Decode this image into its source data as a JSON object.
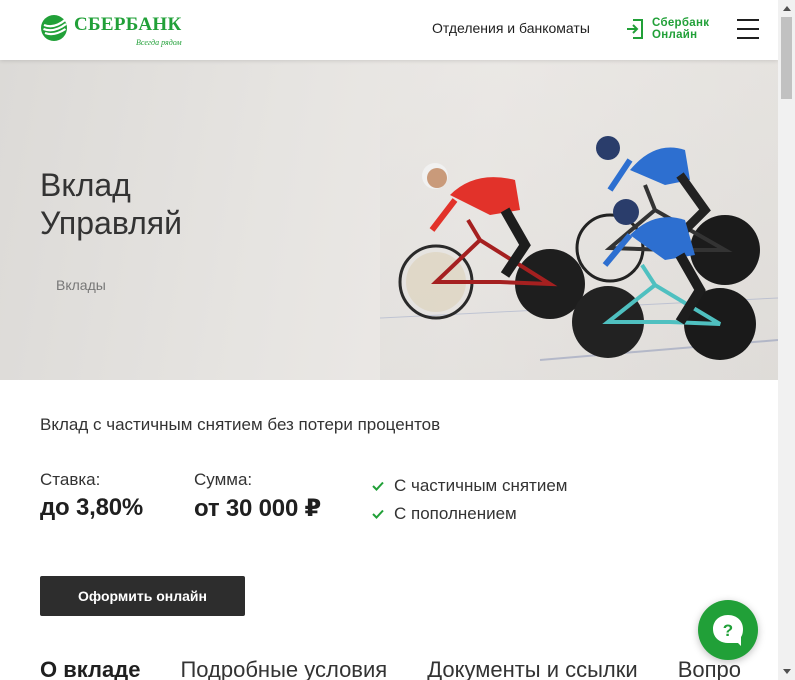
{
  "colors": {
    "brand": "#21a038",
    "cta_bg": "#2d2d2d",
    "text": "#1f1f1f"
  },
  "header": {
    "logo_name": "СБЕРБАНК",
    "logo_slogan": "Всегда рядом",
    "branches_link": "Отделения и банкоматы",
    "online_line1": "Сбербанк",
    "online_line2": "Онлайн",
    "icons": {
      "logo": "sber-logo-icon",
      "online": "login-arrow-icon",
      "menu": "hamburger-menu-icon"
    }
  },
  "hero": {
    "title_line1": "Вклад",
    "title_line2": "Управляй",
    "breadcrumb": "Вклады"
  },
  "product": {
    "subtitle": "Вклад с частичным снятием без потери процентов",
    "rate_label": "Ставка:",
    "rate_value": "до 3,80%",
    "sum_label": "Сумма:",
    "sum_value": "от 30 000 ₽",
    "features": [
      "С частичным снятием",
      "С пополнением"
    ],
    "cta_label": "Оформить онлайн"
  },
  "tabs": [
    "О вкладе",
    "Подробные условия",
    "Документы и ссылки",
    "Вопро"
  ],
  "help_icon": "question-chat-icon"
}
